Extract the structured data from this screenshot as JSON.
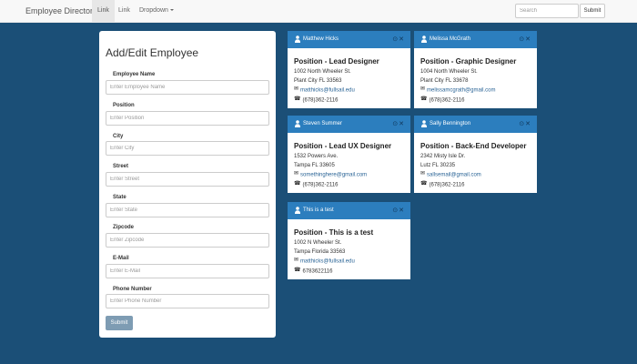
{
  "navbar": {
    "brand": "Employee Directory",
    "links": [
      "Link",
      "Link",
      "Dropdown"
    ],
    "search_placeholder": "Search",
    "submit_label": "Submit"
  },
  "form": {
    "title": "Add/Edit Employee",
    "fields": [
      {
        "label": "Employee Name",
        "placeholder": "Enter Employee Name"
      },
      {
        "label": "Position",
        "placeholder": "Enter Position"
      },
      {
        "label": "City",
        "placeholder": "Enter City"
      },
      {
        "label": "Street",
        "placeholder": "Enter Street"
      },
      {
        "label": "State",
        "placeholder": "Enter State"
      },
      {
        "label": "Zipcode",
        "placeholder": "Enter Zipcode"
      },
      {
        "label": "E-Mail",
        "placeholder": "Enter E-Mail"
      },
      {
        "label": "Phone Number",
        "placeholder": "Enter Phone Number"
      }
    ],
    "submit_label": "Submit"
  },
  "cards": [
    {
      "name": "Matthew Hicks",
      "position": "Position - Lead Designer",
      "street": "1002 North Wheeler St.",
      "city_line": "Plant City FL 33563",
      "email": "matthicks@fullsail.edu",
      "phone": "(678)362-2116",
      "actions": "⊙✕"
    },
    {
      "name": "Melissa McGrath",
      "position": "Position - Graphic Designer",
      "street": "1004 North Wheeler St.",
      "city_line": "Plant City FL 33678",
      "email": "melissamcgrath@gmail.com",
      "phone": "(678)362-2116",
      "actions": "⊙✕"
    },
    {
      "name": "Steven Summer",
      "position": "Position - Lead UX Designer",
      "street": "1532 Powers Ave.",
      "city_line": "Tampa FL 33605",
      "email": "somethinghere@gmail.com",
      "phone": "(678)362-2116",
      "actions": "⊙✕"
    },
    {
      "name": "Sally Bennington",
      "position": "Position - Back-End Developer",
      "street": "2342 Misty Isle Dr.",
      "city_line": "Lutz FL 30235",
      "email": "sallsemail@gmail.com",
      "phone": "(678)362-2116",
      "actions": "⊙✕"
    },
    {
      "name": "This is a test",
      "position": "Position - This is a test",
      "street": "1002 N Wheeler St.",
      "city_line": "Tampa Florida 33563",
      "email": "matthicks@fullsail.edu",
      "phone": "6783622116",
      "actions": "⊙✕"
    }
  ],
  "icons": {
    "user": "user-icon",
    "email": "envelope-icon",
    "phone": "phone-icon",
    "caret": "caret-down-icon"
  },
  "colors": {
    "background": "#1b4f77",
    "card_header": "#2c7ebe",
    "form_submit": "#7e9cb3",
    "link": "#2a6496"
  }
}
